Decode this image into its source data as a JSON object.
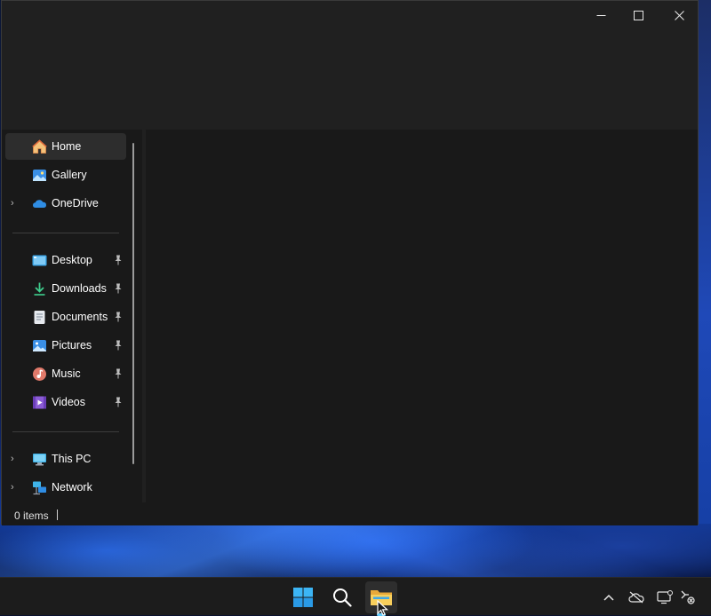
{
  "window": {
    "caption": {
      "minimize": "minimize",
      "maximize": "maximize",
      "close": "close"
    }
  },
  "navigation": {
    "quick": [
      {
        "label": "Home",
        "icon": "home-icon",
        "expandable": false,
        "selected": true
      },
      {
        "label": "Gallery",
        "icon": "gallery-icon",
        "expandable": false
      },
      {
        "label": "OneDrive",
        "icon": "onedrive-icon",
        "expandable": true
      }
    ],
    "pinned": [
      {
        "label": "Desktop",
        "icon": "desktop-folder-icon",
        "pinned": true
      },
      {
        "label": "Downloads",
        "icon": "downloads-icon",
        "pinned": true
      },
      {
        "label": "Documents",
        "icon": "documents-icon",
        "pinned": true
      },
      {
        "label": "Pictures",
        "icon": "pictures-icon",
        "pinned": true
      },
      {
        "label": "Music",
        "icon": "music-icon",
        "pinned": true
      },
      {
        "label": "Videos",
        "icon": "videos-icon",
        "pinned": true
      }
    ],
    "devices": [
      {
        "label": "This PC",
        "icon": "this-pc-icon",
        "expandable": true
      },
      {
        "label": "Network",
        "icon": "network-icon",
        "expandable": true
      }
    ]
  },
  "statusbar": {
    "item_count": "0 items"
  },
  "taskbar": {
    "apps": [
      "start-icon",
      "search-icon",
      "file-explorer-icon"
    ],
    "tray": [
      "show-hidden-icons-chevron",
      "onedrive-offline-icon",
      "display-icon",
      "network-disconnected-icon"
    ]
  },
  "colors": {
    "window_bg": "#191919",
    "titlebar_bg": "#202020",
    "selected_bg": "#2d2d2d",
    "accent": "#60cdff",
    "taskbar_bg": "#1c1c1c"
  }
}
